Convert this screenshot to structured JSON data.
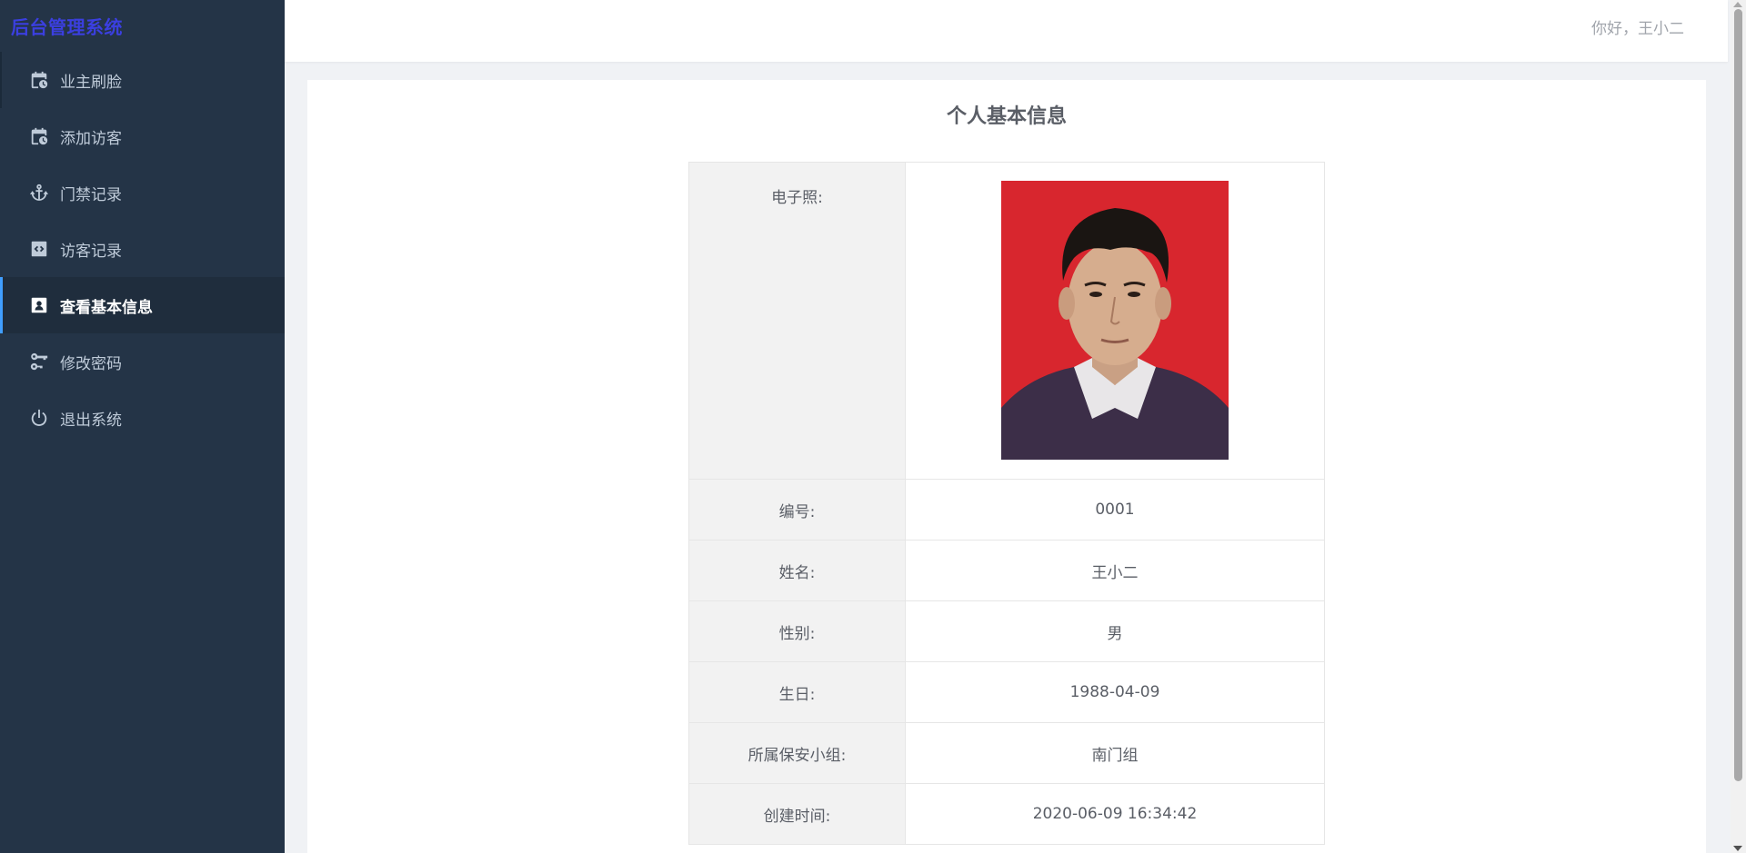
{
  "app": {
    "title": "后台管理系统"
  },
  "header": {
    "greeting": "你好，王小二"
  },
  "sidebar": {
    "items": [
      {
        "label": "业主刷脸",
        "icon": "calendar-clock-icon"
      },
      {
        "label": "添加访客",
        "icon": "calendar-clock-icon"
      },
      {
        "label": "门禁记录",
        "icon": "anchor-icon"
      },
      {
        "label": "访客记录",
        "icon": "code-square-icon"
      },
      {
        "label": "查看基本信息",
        "icon": "contact-card-icon"
      },
      {
        "label": "修改密码",
        "icon": "key-icon"
      },
      {
        "label": "退出系统",
        "icon": "power-icon"
      }
    ],
    "active_index": 4
  },
  "profile": {
    "title": "个人基本信息",
    "photo_label": "电子照:",
    "rows": [
      {
        "label": "编号:",
        "value": "0001"
      },
      {
        "label": "姓名:",
        "value": "王小二"
      },
      {
        "label": "性别:",
        "value": "男"
      },
      {
        "label": "生日:",
        "value": "1988-04-09"
      },
      {
        "label": "所属保安小组:",
        "value": "南门组"
      },
      {
        "label": "创建时间:",
        "value": "2020-06-09 16:34:42"
      }
    ]
  },
  "colors": {
    "sidebar_bg": "#243447",
    "brand": "#3b3fe0",
    "active_indicator": "#409eff",
    "photo_bg": "#d8262e"
  }
}
